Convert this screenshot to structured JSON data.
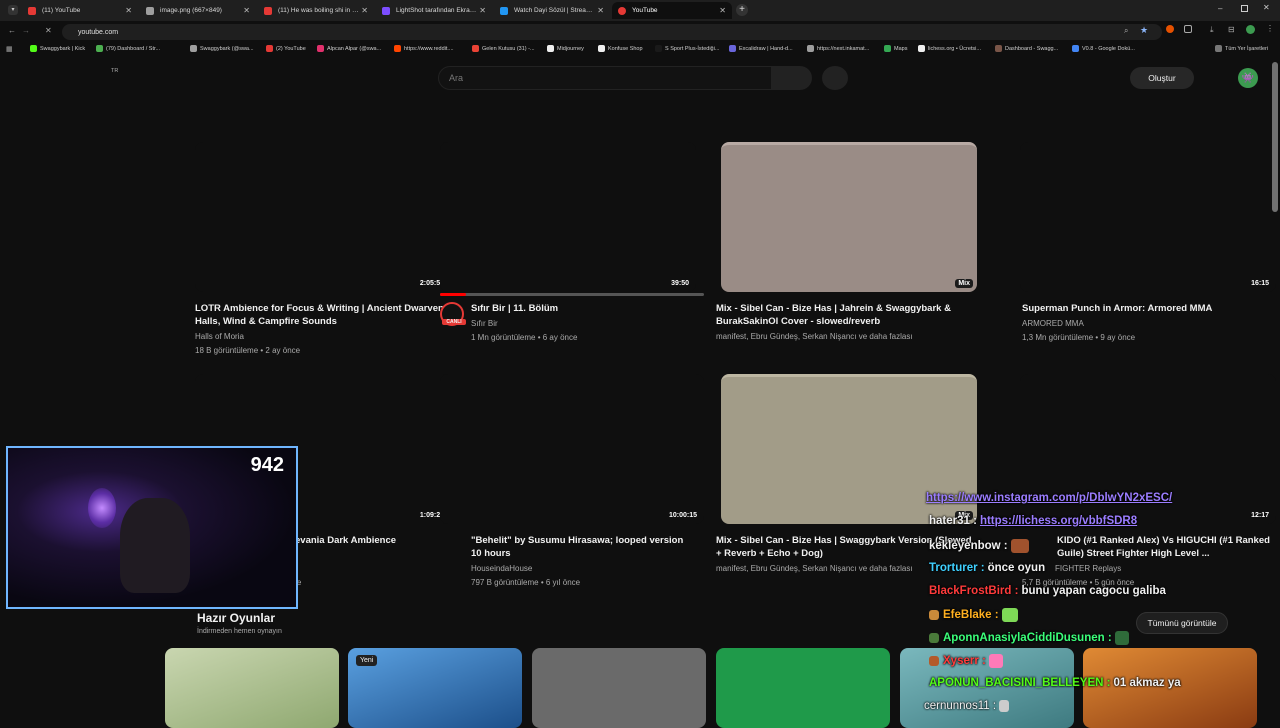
{
  "tabs": [
    {
      "label": "(11) YouTube",
      "color": "#e53935"
    },
    {
      "label": "image.png (667×849)",
      "color": "#9e9e9e"
    },
    {
      "label": "(11) He was boiling shi in a kett",
      "color": "#e53935"
    },
    {
      "label": "LightShot tarafından Ekran Gör",
      "color": "#7c4dff"
    },
    {
      "label": "Watch Dayi Sözül | Streamable",
      "color": "#2196f3"
    },
    {
      "label": "YouTube",
      "color": "#e53935"
    }
  ],
  "address": {
    "url": "youtube.com"
  },
  "bookmarks": [
    {
      "label": "Swaggybark | Kick",
      "color": "#53fc18"
    },
    {
      "label": "(79) Dashboard / Str...",
      "color": "#4caf50"
    },
    {
      "label": "Swaggybark (@swa...",
      "color": "#9e9e9e"
    },
    {
      "label": "(2) YouTube",
      "color": "#e53935"
    },
    {
      "label": "Alpcan Alpar (@swa...",
      "color": "#e1306c"
    },
    {
      "label": "https://www.reddit....",
      "color": "#ff4500"
    },
    {
      "label": "Gelen Kutusu (31) -...",
      "color": "#ea4335"
    },
    {
      "label": "Midjourney",
      "color": "#eeeeee"
    },
    {
      "label": "Konfuse Shop",
      "color": "#eeeeee"
    },
    {
      "label": "S Sport Plus-İstediği...",
      "color": "#1a1a1a"
    },
    {
      "label": "Excalidraw | Hand-d...",
      "color": "#6965db"
    },
    {
      "label": "https://next.inkamat...",
      "color": "#9e9e9e"
    },
    {
      "label": "Maps",
      "color": "#34a853"
    },
    {
      "label": "lichess.org • Ücretsi...",
      "color": "#eeeeee"
    },
    {
      "label": "Dashboard - Swagg...",
      "color": "#795548"
    },
    {
      "label": "V0.8 - Google Dokü...",
      "color": "#4285f4"
    }
  ],
  "bookmarks_all": "Tüm Yer İşaretleri",
  "yt": {
    "region": "TR",
    "search_placeholder": "Ara",
    "create_label": "Oluştur"
  },
  "videos": [
    {
      "title": "LOTR Ambience for Focus & Writing | Ancient Dwarven Halls, Wind & Campfire Sounds",
      "channel": "Halls of Moria",
      "meta": "18 B görüntüleme • 2 ay önce",
      "duration": "2:05:54"
    },
    {
      "title": "Sıfır Bir | 11. Bölüm",
      "channel": "Sıfır Bir",
      "meta": "1 Mn görüntüleme • 6 ay önce",
      "duration": "39:50",
      "live_badge": "CANLI"
    },
    {
      "title": "Mix - Sibel Can - Bize Has | Jahrein & Swaggybark & BurakSakinOl Cover - slowed/reverb",
      "channel": "manifest, Ebru Gündeş, Serkan Nişancı ve daha fazlası",
      "meta": "",
      "duration": "Mix"
    },
    {
      "title": "Superman Punch in Armor: Armored MMA",
      "channel": "ARMORED MMA",
      "meta": "1,3 Mn görüntüleme • 9 ay önce",
      "duration": "16:15"
    },
    {
      "title": "evania Dark Ambience",
      "channel": "",
      "meta": "once",
      "duration": "1:09:27"
    },
    {
      "title": "\"Behelit\" by Susumu Hirasawa; looped version 10 hours",
      "channel": "HouseindaHouse",
      "meta": "797 B görüntüleme • 6 yıl önce",
      "duration": "10:00:15"
    },
    {
      "title": "Mix - Sibel Can - Bize Has | Swaggybark Version (Slowed + Reverb + Echo + Dog)",
      "channel": "manifest, Ebru Gündeş, Serkan Nişancı ve daha fazlası",
      "meta": "",
      "duration": "Mix"
    },
    {
      "title": "KIDO (#1 Ranked Alex) Vs HIGUCHI (#1 Ranked Guile) Street Fighter High Level ...",
      "channel": "FIGHTER Replays",
      "meta": "5,7 B görüntüleme • 5 gün önce",
      "duration": "12:17"
    }
  ],
  "webcam": {
    "count": "942"
  },
  "playables": {
    "title": "Hazır Oyunlar",
    "subtitle": "İndirmeden hemen oynayın",
    "new_badge": "Yeni",
    "view_all": "Tümünü görüntüle",
    "colors": [
      "#b6c8a0",
      "#3b82c4",
      "#6a6a6a",
      "#1f9a4a",
      "#5fa3a8",
      "#d0782a"
    ]
  },
  "chat": [
    {
      "user": "",
      "msg": "https://www.instagram.com/p/DblwYN2xESC/",
      "ucolor": "#9b7dff",
      "link": true
    },
    {
      "user": "hater31 :",
      "msg": "https://lichess.org/vbbfSDR8",
      "ucolor": "#f1f1f1",
      "link": true
    },
    {
      "user": "kekleyenbow :",
      "msg": "",
      "ucolor": "#f1f1f1"
    },
    {
      "user": "Trorturer :",
      "msg": "önce oyun",
      "ucolor": "#3fd0ff"
    },
    {
      "user": "BlackFrostBird :",
      "msg": "bunu yapan cagocu galiba",
      "ucolor": "#ff3b3b"
    },
    {
      "user": "EfeBlake :",
      "msg": "",
      "ucolor": "#ffb020"
    },
    {
      "user": "AponnAnasiylaCiddiDusunen :",
      "msg": "",
      "ucolor": "#3bff7a"
    },
    {
      "user": "Xyserr :",
      "msg": "",
      "ucolor": "#ff3b3b"
    },
    {
      "user": "APONUN_BACISINI_BELLEYEN :",
      "msg": "01 akmaz ya",
      "ucolor": "#53fc18"
    },
    {
      "user": "cernunnos11 :",
      "msg": "",
      "ucolor": "#f1f1f1"
    }
  ]
}
